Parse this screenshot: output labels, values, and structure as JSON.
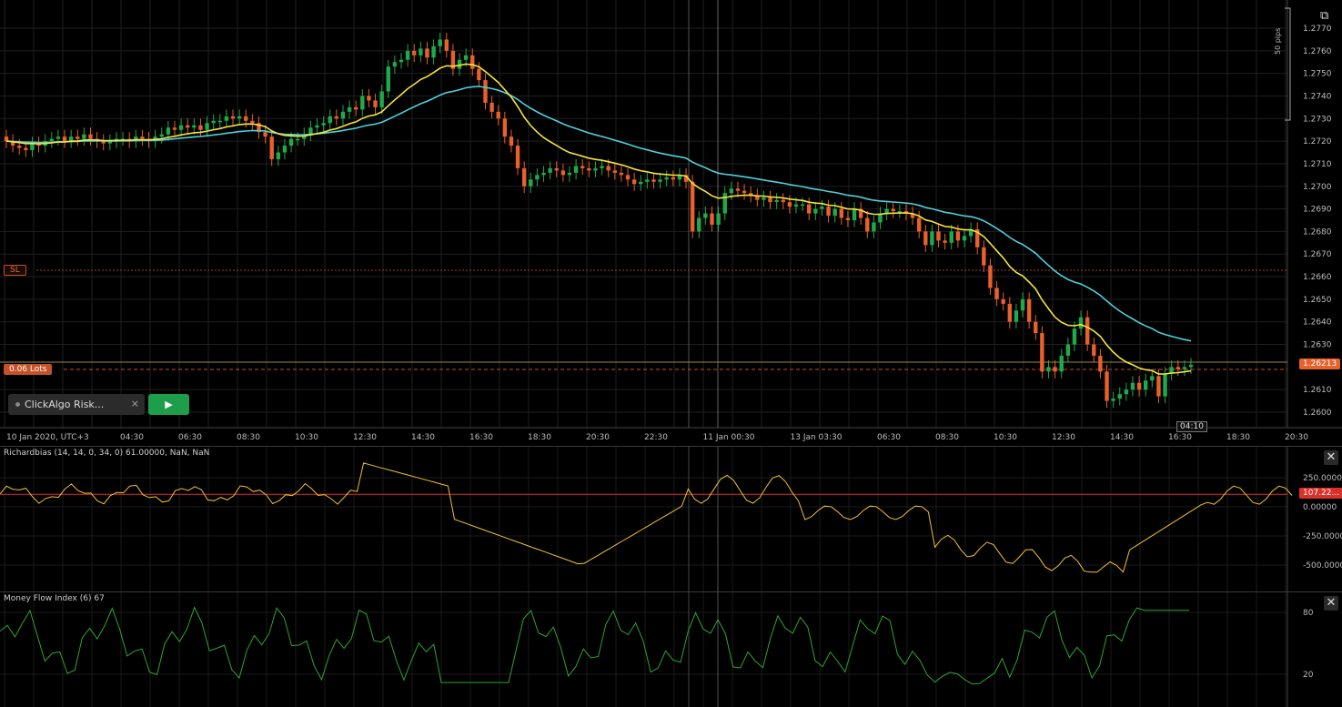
{
  "chart": {
    "timezone_label": "10 Jan 2020, UTC+3",
    "price_axis": [
      "1.2770",
      "1.2760",
      "1.2750",
      "1.2740",
      "1.2730",
      "1.2720",
      "1.2710",
      "1.2700",
      "1.2690",
      "1.2680",
      "1.2670",
      "1.2660",
      "1.2650",
      "1.2640",
      "1.2630",
      "1.2610",
      "1.2600"
    ],
    "time_axis": [
      "04:30",
      "06:30",
      "08:30",
      "10:30",
      "12:30",
      "14:30",
      "16:30",
      "18:30",
      "20:30",
      "22:30",
      "11 Jan 00:30",
      "13 Jan 03:30",
      "06:30",
      "08:30",
      "10:30",
      "12:30",
      "14:30",
      "16:30",
      "18:30",
      "20:30"
    ],
    "current_price": "1.26213",
    "pips_label": "50 pips",
    "time_badge": "04:10",
    "sl_label": "SL",
    "lots_label": "0.06 Lots",
    "colors": {
      "bull": "#1faa4a",
      "bear": "#e8602a",
      "ma_fast": "#f5e43a",
      "ma_slow": "#4fd0dc",
      "price_tag": "#e8602a"
    }
  },
  "toolbar": {
    "algo_label": "ClickAlgo Risk...",
    "algo_close": "×",
    "play_label": "▶",
    "popout_icon": "⧉"
  },
  "richardbias": {
    "title": "Richardbias (14, 14, 0, 34, 0) 61.00000, NaN, NaN",
    "axis": [
      "250.00000",
      "0.00000",
      "-250.00000",
      "-500.00000"
    ],
    "level_tag": "107.22...",
    "close": "✕"
  },
  "mfi": {
    "title": "Money Flow Index (6) 67",
    "axis": [
      "80",
      "20"
    ],
    "close": "✕"
  }
}
